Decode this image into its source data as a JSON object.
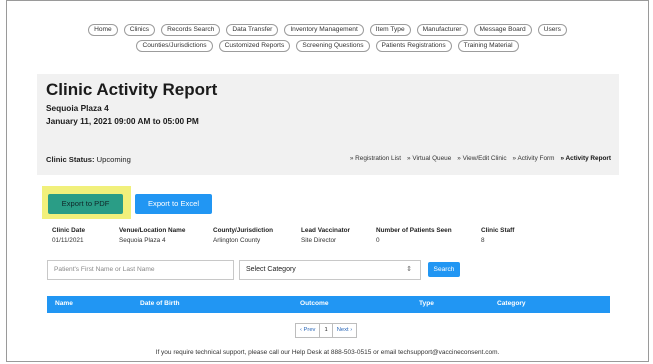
{
  "nav": {
    "row1": [
      "Home",
      "Clinics",
      "Records Search",
      "Data Transfer",
      "Inventory Management",
      "Item Type",
      "Manufacturer",
      "Message Board",
      "Users"
    ],
    "row2": [
      "Counties/Jurisdictions",
      "Customized Reports",
      "Screening Questions",
      "Patients Registrations",
      "Training Material"
    ]
  },
  "report": {
    "title": "Clinic Activity Report",
    "location": "Sequoia Plaza 4",
    "datetime": "January 11, 2021 09:00 AM to 05:00 PM",
    "status_label": "Clinic Status:",
    "status_value": "Upcoming"
  },
  "links": [
    "» Registration List",
    "» Virtual Queue",
    "» View/Edit Clinic",
    "» Activity Form",
    "» Activity Report"
  ],
  "buttons": {
    "pdf": "Export to PDF",
    "excel": "Export to Excel",
    "search": "Search"
  },
  "info": [
    {
      "header": "Clinic Date",
      "value": "01/11/2021"
    },
    {
      "header": "Venue/Location Name",
      "value": "Sequoia Plaza 4"
    },
    {
      "header": "County/Jurisdiction",
      "value": "Arlington County"
    },
    {
      "header": "Lead Vaccinator",
      "value": "Site Director"
    },
    {
      "header": "Number of Patients Seen",
      "value": "0"
    },
    {
      "header": "Clinic Staff",
      "value": "8"
    }
  ],
  "search": {
    "placeholder": "Patient's First Name or Last Name",
    "category": "Select Category"
  },
  "table": {
    "columns": [
      "Name",
      "Date of Birth",
      "Outcome",
      "Type",
      "Category"
    ]
  },
  "pager": {
    "prev": "‹ Prev",
    "current": "1",
    "next": "Next ›"
  },
  "footer": "If you require technical support, please call our Help Desk at 888-503-0515 or email techsupport@vaccineconsent.com."
}
